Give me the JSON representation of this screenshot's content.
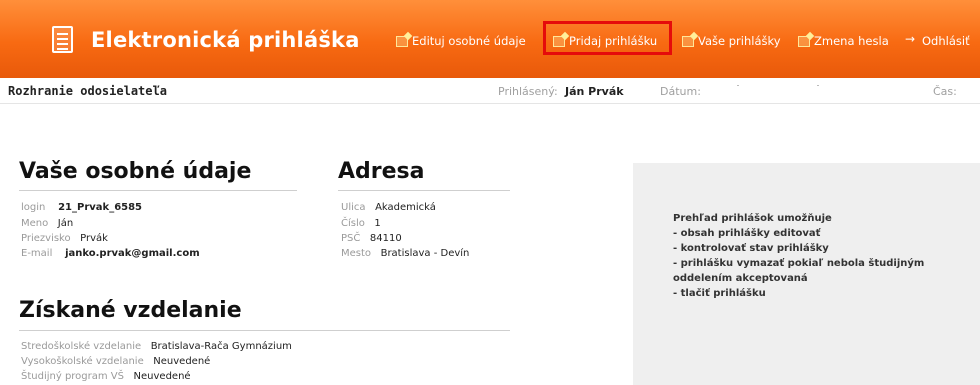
{
  "header": {
    "app_title": "Elektronická prihláška",
    "logo_icon": "document-icon",
    "nav": [
      {
        "label": "Edituj osobné údaje",
        "icon": "edit-doc-icon"
      },
      {
        "label": "Pridaj prihlášku",
        "icon": "add-doc-icon"
      },
      {
        "label": "Vaše prihlášky",
        "icon": "docs-icon"
      },
      {
        "label": "Zmena hesla",
        "icon": "edit-doc-icon"
      },
      {
        "label": "Odhlásiť",
        "icon": "logout-icon"
      }
    ],
    "highlight_color": "#e50b0b",
    "bar_color": "#f8761e"
  },
  "subbar": {
    "interface_title": "Rozhranie odosielateľa",
    "logged_label": "Prihlásený:",
    "logged_user": "Ján Prvák",
    "date_label": "Dátum:",
    "time_label": "Čas:"
  },
  "personal": {
    "title": "Vaše osobné údaje",
    "fields": [
      {
        "label": "login",
        "value": "21_Prvak_6585"
      },
      {
        "label": "Meno",
        "value": "Ján"
      },
      {
        "label": "Priezvisko",
        "value": "Prvák"
      },
      {
        "label": "E-mail",
        "value": "janko.prvak@gmail.com"
      }
    ]
  },
  "address": {
    "title": "Adresa",
    "fields": [
      {
        "label": "Ulica",
        "value": "Akademická"
      },
      {
        "label": "Číslo",
        "value": "1"
      },
      {
        "label": "PSČ",
        "value": "84110"
      },
      {
        "label": "Mesto",
        "value": "Bratislava - Devín"
      }
    ]
  },
  "education": {
    "title": "Získané vzdelanie",
    "fields": [
      {
        "label": "Stredoškolské vzdelanie",
        "value": "Bratislava-Rača Gymnázium"
      },
      {
        "label": "Vysokoškolské vzdelanie",
        "value": "Neuvedené"
      },
      {
        "label": "Študijný program VŠ",
        "value": "Neuvedené"
      }
    ]
  },
  "info": {
    "lines": [
      "Prehľad prihlášok umožňuje",
      "- obsah prihlášky editovať",
      "- kontrolovať stav prihlášky",
      "- prihlášku vymazať pokiaľ nebola študijným",
      "oddelením akceptovaná",
      "- tlačiť prihlášku"
    ]
  }
}
